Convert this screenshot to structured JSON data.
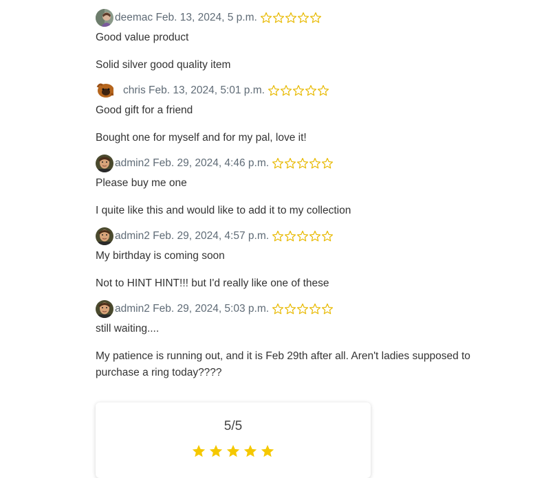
{
  "reviews": [
    {
      "author": "deemac",
      "date": "Feb. 13, 2024, 5 p.m.",
      "rating": 0,
      "title": "Good value product",
      "body": "Solid silver good quality item",
      "avatar": "person-photo"
    },
    {
      "author": "chris",
      "date": "Feb. 13, 2024, 5:01 p.m.",
      "rating": 0,
      "title": "Good gift for a friend",
      "body": "Bought one for myself and for my pal, love it!",
      "avatar": "orangutan-photo"
    },
    {
      "author": "admin2",
      "date": "Feb. 29, 2024, 4:46 p.m.",
      "rating": 0,
      "title": "Please buy me one",
      "body": "I quite like this and would like to add it to my collection",
      "avatar": "man-photo"
    },
    {
      "author": "admin2",
      "date": "Feb. 29, 2024, 4:57 p.m.",
      "rating": 0,
      "title": "My birthday is coming soon",
      "body": "Not to HINT HINT!!! but I'd really like one of these",
      "avatar": "man-photo"
    },
    {
      "author": "admin2",
      "date": "Feb. 29, 2024, 5:03 p.m.",
      "rating": 0,
      "title": "still waiting....",
      "body": "My patience is running out, and it is Feb 29th after all. Aren't ladies supposed to purchase a ring today????",
      "avatar": "man-photo"
    }
  ],
  "summary": {
    "score": "5/5",
    "stars": 5
  },
  "colors": {
    "star": "#f5c800",
    "star_outline": "#e8b900",
    "meta_text": "#5f6b76"
  }
}
